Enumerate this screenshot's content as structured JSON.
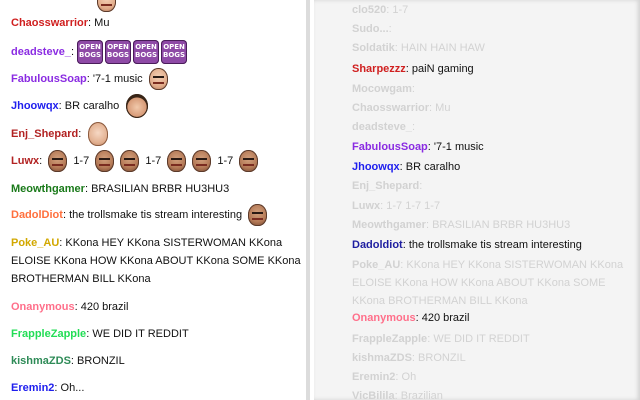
{
  "left_chat": {
    "top_partial": {
      "user": "",
      "color": "#1e1ea0"
    },
    "messages": [
      {
        "user": "Chaosswarrior",
        "color": "#d02020",
        "text": "Mu"
      },
      {
        "user": "deadsteve_",
        "color": "#8a2be2",
        "emotes": [
          "OPEN",
          "OPEN",
          "OPEN",
          "OPEN"
        ],
        "emote_sub": "BOGS"
      },
      {
        "user": "FabulousSoap",
        "color": "#8a2be2",
        "text": "'7-1 music"
      },
      {
        "user": "Jhoowqx",
        "color": "#1e1eee",
        "text": "BR caralho"
      },
      {
        "user": "Enj_Shepard",
        "color": "#b22222",
        "text": ""
      },
      {
        "user": "Luwx",
        "color": "#b22222",
        "text_parts": [
          "1-7",
          "1-7",
          "1-7"
        ]
      },
      {
        "user": "Meowthgamer",
        "color": "#1a7a1a",
        "text": "BRASILIAN BRBR HU3HU3"
      },
      {
        "user": "DadolDiot",
        "color": "#ff6f3c",
        "text": "the trollsmake tis stream interesting"
      },
      {
        "user": "Poke_AU",
        "color": "#d2a800",
        "text": "KKona HEY KKona SISTERWOMAN KKona ELOISE KKona HOW KKona ABOUT KKona SOME KKona BROTHERMAN BILL KKona"
      },
      {
        "user": "Onanymous",
        "color": "#ff6f8a",
        "text": "420 brazil"
      },
      {
        "user": "FrappleZapple",
        "color": "#22dd55",
        "text": "WE DID IT REDDIT"
      },
      {
        "user": "kishmaZDS",
        "color": "#2e8b57",
        "text": "BRONZIL"
      },
      {
        "user": "Eremin2",
        "color": "#1e1eee",
        "text": "Oh..."
      }
    ]
  },
  "right_chat": {
    "messages": [
      {
        "user": "clo520",
        "text": "1-7",
        "faded": true
      },
      {
        "user": "Sudo...",
        "text": "",
        "faded": true
      },
      {
        "user": "Soldatik",
        "text": "HAIN HAIN HAW",
        "faded": true
      },
      {
        "user": "Sharpezzz",
        "color": "#d02020",
        "text": "paiN gaming",
        "faded": false
      },
      {
        "user": "Mocowgam",
        "text": "",
        "faded": true
      },
      {
        "user": "Chaosswarrior",
        "text": "Mu",
        "faded": true
      },
      {
        "user": "deadsteve_",
        "text": "",
        "faded": true
      },
      {
        "user": "FabulousSoap",
        "color": "#8a2be2",
        "text": "'7-1 music",
        "faded": false
      },
      {
        "user": "Jhoowqx",
        "color": "#1e1eee",
        "text": "BR caralho",
        "faded": false
      },
      {
        "user": "Enj_Shepard",
        "text": "",
        "faded": true
      },
      {
        "user": "Luwx",
        "text": "1-7 1-7 1-7",
        "faded": true
      },
      {
        "user": "Meowthgamer",
        "text": "BRASILIAN BRBR HU3HU3",
        "faded": true
      },
      {
        "user": "Dadoldiot",
        "color": "#1e1ea0",
        "text": "the trollsmake tis stream interesting",
        "faded": false
      },
      {
        "user": "Poke_AU",
        "text": "KKona HEY KKona SISTERWOMAN KKona ELOISE KKona HOW KKona ABOUT KKona SOME KKona BROTHERMAN BILL KKona",
        "faded": true
      },
      {
        "user": "Onanymous",
        "color": "#ff6f8a",
        "text": "420 brazil",
        "faded": false
      },
      {
        "user": "FrappleZapple",
        "text": "WE DID IT REDDIT",
        "faded": true
      },
      {
        "user": "kishmaZDS",
        "text": "BRONZIL",
        "faded": true
      },
      {
        "user": "Eremin2",
        "text": "Oh",
        "faded": true
      },
      {
        "user": "VicBilila",
        "text": "Brazilian",
        "faded": true
      }
    ]
  }
}
